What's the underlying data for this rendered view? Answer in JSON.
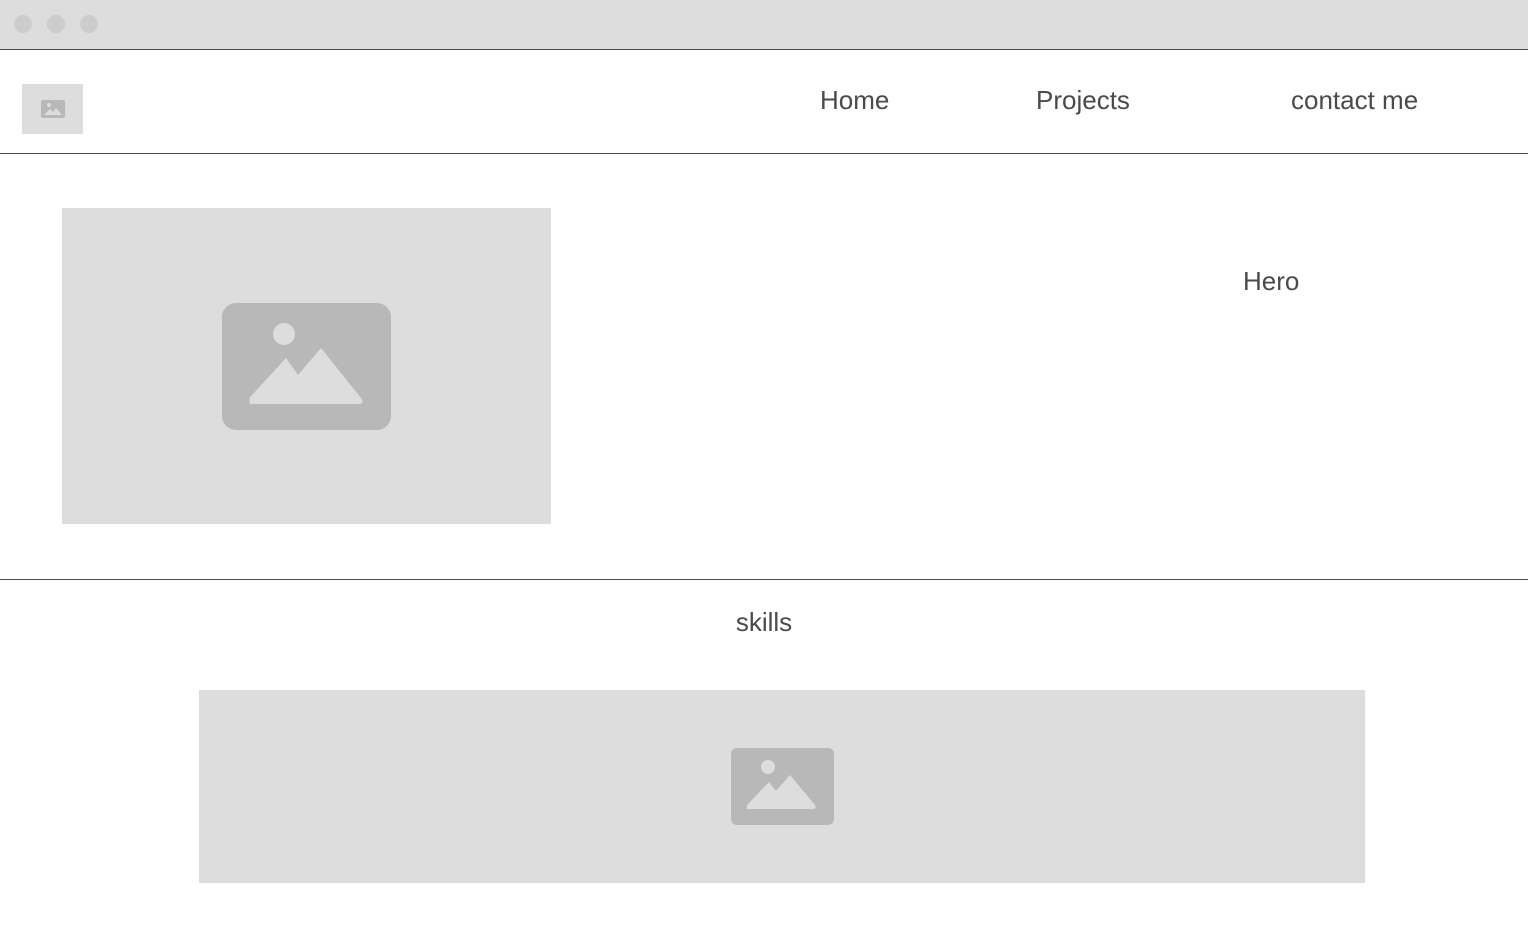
{
  "nav": {
    "home_label": "Home",
    "projects_label": "Projects",
    "contact_label": "contact me"
  },
  "hero": {
    "text": "Hero",
    "image_icon": "image-placeholder-icon"
  },
  "skills": {
    "title": "skills",
    "image_icon": "image-placeholder-icon"
  },
  "colors": {
    "placeholder_bg": "#dddddd",
    "placeholder_icon": "#b8b8b8",
    "text": "#4a4a4a",
    "border": "#4a4a4a"
  }
}
